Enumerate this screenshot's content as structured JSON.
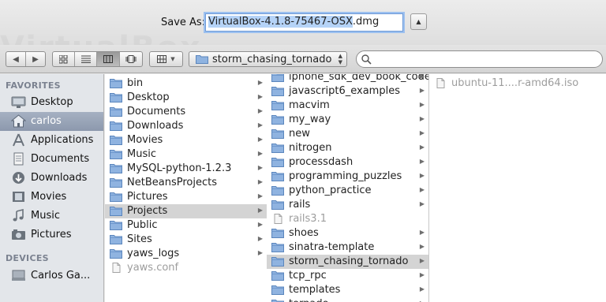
{
  "dialog": {
    "save_as_label": "Save As:",
    "filename_selected": "VirtualBox-4.1.8-75467-OSX",
    "filename_ext": ".dmg"
  },
  "toolbar": {
    "location": "storm_chasing_tornado",
    "search_placeholder": ""
  },
  "sidebar": {
    "favorites_heading": "FAVORITES",
    "favorites": [
      {
        "label": "Desktop",
        "icon": "desktop-icon"
      },
      {
        "label": "carlos",
        "icon": "home-icon",
        "selected": true
      },
      {
        "label": "Applications",
        "icon": "applications-icon"
      },
      {
        "label": "Documents",
        "icon": "documents-icon"
      },
      {
        "label": "Downloads",
        "icon": "downloads-icon"
      },
      {
        "label": "Movies",
        "icon": "movies-icon"
      },
      {
        "label": "Music",
        "icon": "music-icon"
      },
      {
        "label": "Pictures",
        "icon": "pictures-icon"
      }
    ],
    "devices_heading": "DEVICES",
    "devices": [
      {
        "label": "Carlos Ga...",
        "icon": "computer-icon"
      }
    ]
  },
  "columns": {
    "home": [
      {
        "name": "bin"
      },
      {
        "name": "Desktop"
      },
      {
        "name": "Documents"
      },
      {
        "name": "Downloads"
      },
      {
        "name": "Movies"
      },
      {
        "name": "Music"
      },
      {
        "name": "MySQL-python-1.2.3"
      },
      {
        "name": "NetBeansProjects"
      },
      {
        "name": "Pictures"
      },
      {
        "name": "Projects",
        "selected": true
      },
      {
        "name": "Public"
      },
      {
        "name": "Sites"
      },
      {
        "name": "yaws_logs"
      },
      {
        "name": "yaws.conf",
        "file": true
      }
    ],
    "projects": [
      {
        "name": "iphone_sdk_dev_book_code"
      },
      {
        "name": "javascript6_examples"
      },
      {
        "name": "macvim"
      },
      {
        "name": "my_way"
      },
      {
        "name": "new"
      },
      {
        "name": "nitrogen"
      },
      {
        "name": "processdash"
      },
      {
        "name": "programming_puzzles"
      },
      {
        "name": "python_practice"
      },
      {
        "name": "rails"
      },
      {
        "name": "rails3.1",
        "file": true
      },
      {
        "name": "shoes"
      },
      {
        "name": "sinatra-template"
      },
      {
        "name": "storm_chasing_tornado",
        "selected": true
      },
      {
        "name": "tcp_rpc"
      },
      {
        "name": "templates"
      },
      {
        "name": "tornado"
      }
    ],
    "storm": [
      {
        "name": "ubuntu-11....r-amd64.iso",
        "file": true
      }
    ]
  },
  "colors": {
    "accent": "#6f9bd8",
    "selection": "#b5d3f7",
    "sidebar_bg": "#e3e6ea",
    "row_selected": "#d4d4d4"
  }
}
